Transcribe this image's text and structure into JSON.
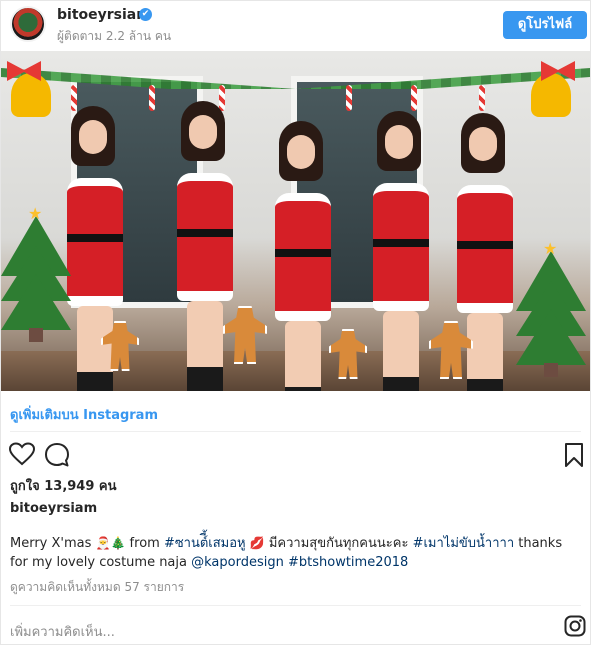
{
  "header": {
    "username": "bitoeyrsiam",
    "verified_mark": "✔",
    "followers": "ผู้ติดตาม 2.2 ล้าน คน",
    "view_profile_label": "ดูโปรไฟล์",
    "accent_color": "#3897f0"
  },
  "media": {
    "icons": [
      "gingerbread-sticker",
      "christmas-tree-sticker",
      "bell-sticker",
      "candy-cane-sticker",
      "garland-sticker"
    ]
  },
  "see_more_label": "ดูเพิ่มเติมบน Instagram",
  "actions": {
    "icons": [
      "heart-icon",
      "comment-icon",
      "bookmark-icon"
    ]
  },
  "likes": "ถูกใจ 13,949 คน",
  "caption": {
    "username": "bitoeyrsiam",
    "text_1": "Merry X'mas ",
    "emoji_1": "🎅",
    "emoji_2": "🎄",
    "text_2": " from ",
    "hashtag_1": "#ซานต์ี้เสมอหู",
    "emoji_3": "💋",
    "text_3": " มีความสุขกันทุกคนนะคะ ",
    "hashtag_2": "#เมาไม่ขับน้ำาาา",
    "text_4": " thanks for my lovely costume naja ",
    "mention": "@kapordesign",
    "text_5": " ",
    "hashtag_3": "#btshowtime2018"
  },
  "view_comments": "ดูความคิดเห็นทั้งหมด 57 รายการ",
  "add_comment_placeholder": "เพิ่มความคิดเห็น...",
  "footer": {
    "icons": [
      "instagram-logo-icon"
    ]
  }
}
